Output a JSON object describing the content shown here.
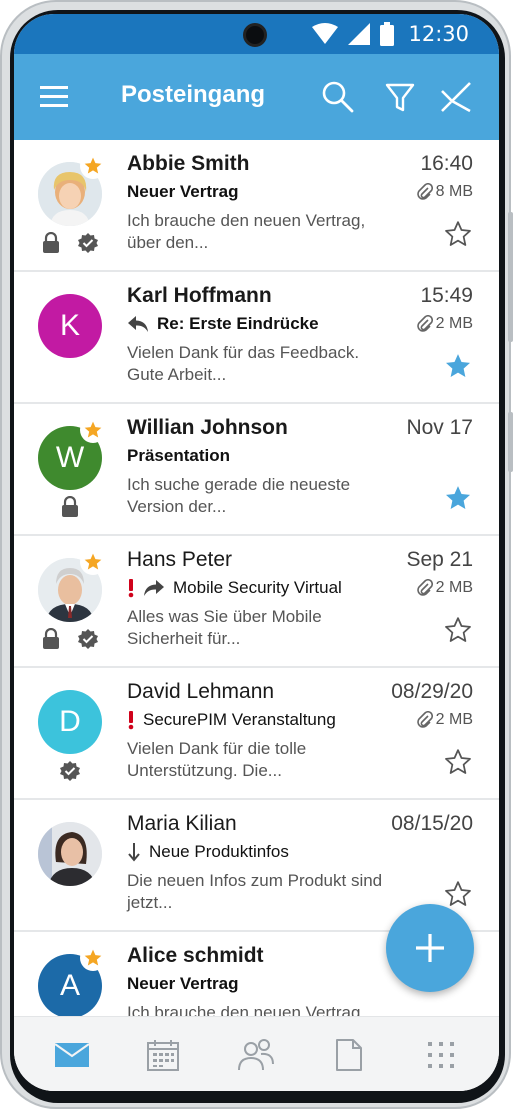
{
  "status_bar": {
    "time": "12:30"
  },
  "app_bar": {
    "title": "Posteingang"
  },
  "colors": {
    "brand": "#4aa6dc",
    "status_bar": "#1b76bd",
    "star_active": "#4aa6dc",
    "favorite_badge": "#f5a623",
    "alert": "#d0021b"
  },
  "messages": [
    {
      "sender": "Abbie Smith",
      "time": "16:40",
      "subject": "Neuer Vertrag",
      "size": "8 MB",
      "preview": "Ich brauche den neuen Vertrag, über den...",
      "unread": true,
      "starred": false,
      "avatar": "photo-woman-blonde",
      "favorite": true,
      "encrypted": true,
      "signed": true
    },
    {
      "sender": "Karl Hoffmann",
      "time": "15:49",
      "subject": "Re: Erste Eindrücke",
      "size": "2 MB",
      "preview": "Vielen Dank für das Feedback. Gute Arbeit...",
      "unread": true,
      "starred": true,
      "avatar_letter": "K",
      "avatar_color": "#c21aa3",
      "replied": true
    },
    {
      "sender": "Willian Johnson",
      "time": "Nov 17",
      "subject": "Präsentation",
      "size": "",
      "preview": "Ich suche gerade die neueste Version der...",
      "unread": true,
      "starred": true,
      "avatar_letter": "W",
      "avatar_color": "#3f8a2e",
      "favorite": true,
      "encrypted": true
    },
    {
      "sender": "Hans Peter",
      "time": "Sep 21",
      "subject": "Mobile Security Virtual",
      "size": "2 MB",
      "preview": "Alles was Sie über Mobile Sicherheit für...",
      "unread": false,
      "starred": false,
      "avatar": "photo-man-suit",
      "favorite": true,
      "important": true,
      "forwarded": true,
      "encrypted": true,
      "signed": true
    },
    {
      "sender": "David Lehmann",
      "time": "08/29/20",
      "subject": "SecurePIM Veranstaltung",
      "size": "2 MB",
      "preview": "Vielen Dank für die tolle Unterstützung. Die...",
      "unread": false,
      "starred": false,
      "avatar_letter": "D",
      "avatar_color": "#3cc3dc",
      "important": true,
      "signed": true
    },
    {
      "sender": "Maria Kilian",
      "time": "08/15/20",
      "subject": "Neue Produktinfos",
      "size": "",
      "preview": "Die neuen Infos zum Produkt sind jetzt...",
      "unread": false,
      "starred": false,
      "avatar": "photo-woman-dark",
      "low_priority": true
    },
    {
      "sender": "Alice schmidt",
      "time": "",
      "subject": "Neuer Vertrag",
      "size": "",
      "preview": "Ich brauche den neuen Vertrag",
      "unread": true,
      "starred": false,
      "avatar_letter": "A",
      "avatar_color": "#1c6aa8",
      "favorite": true
    }
  ],
  "bottom_nav": [
    "mail-icon",
    "calendar-icon",
    "contacts-icon",
    "document-icon",
    "apps-grid-icon"
  ]
}
